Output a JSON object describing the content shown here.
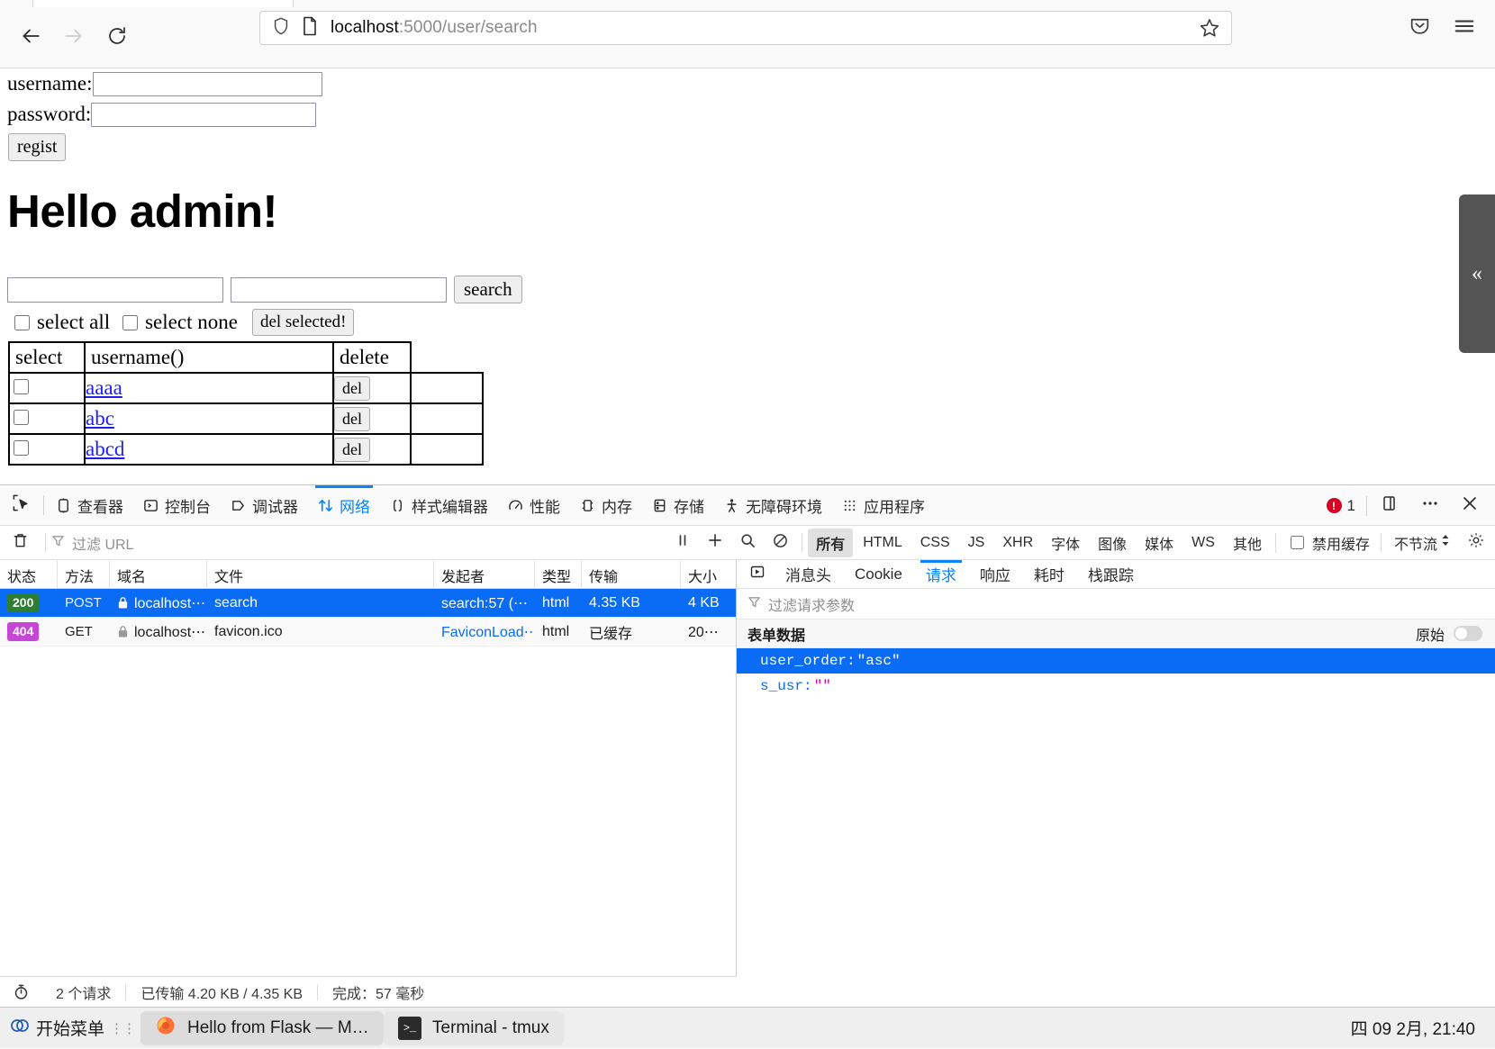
{
  "browser": {
    "url_host": "localhost",
    "url_path": ":5000/user/search",
    "back_icon": "back-arrow-icon",
    "forward_icon": "forward-arrow-icon",
    "reload_icon": "reload-icon",
    "shield_icon": "shield-icon",
    "page_icon": "page-document-icon",
    "star_icon": "bookmark-star-icon",
    "pocket_icon": "pocket-icon",
    "menu_icon": "hamburger-menu-icon"
  },
  "page": {
    "username_label": "username:",
    "password_label": "password:",
    "username_value": "",
    "password_value": "",
    "regist_label": "regist",
    "heading": "Hello admin!",
    "search_value_1": "",
    "search_value_2": "",
    "search_label": "search",
    "select_all_label": "select all",
    "select_none_label": "select none",
    "del_selected_label": "del selected!",
    "table": {
      "headers": [
        "select",
        "username()",
        "delete"
      ],
      "rows": [
        {
          "username": "aaaa",
          "del_label": "del",
          "checked": false
        },
        {
          "username": "abc",
          "del_label": "del",
          "checked": false
        },
        {
          "username": "abcd",
          "del_label": "del",
          "checked": false
        }
      ]
    },
    "side_handle_icon": "collapse-left-chevrons"
  },
  "devtools": {
    "tabs": [
      {
        "label": "查看器",
        "icon": "inspector-icon",
        "active": false
      },
      {
        "label": "控制台",
        "icon": "console-icon",
        "active": false
      },
      {
        "label": "调试器",
        "icon": "debugger-icon",
        "active": false
      },
      {
        "label": "网络",
        "icon": "network-icon",
        "active": true
      },
      {
        "label": "样式编辑器",
        "icon": "style-editor-icon",
        "active": false
      },
      {
        "label": "性能",
        "icon": "performance-icon",
        "active": false
      },
      {
        "label": "内存",
        "icon": "memory-icon",
        "active": false
      },
      {
        "label": "存储",
        "icon": "storage-icon",
        "active": false
      },
      {
        "label": "无障碍环境",
        "icon": "accessibility-icon",
        "active": false
      },
      {
        "label": "应用程序",
        "icon": "application-icon",
        "active": false
      }
    ],
    "error_count": "1",
    "filterbar": {
      "filter_placeholder": "过滤 URL",
      "types": [
        {
          "label": "所有",
          "active": true
        },
        {
          "label": "HTML",
          "active": false
        },
        {
          "label": "CSS",
          "active": false
        },
        {
          "label": "JS",
          "active": false
        },
        {
          "label": "XHR",
          "active": false
        },
        {
          "label": "字体",
          "active": false
        },
        {
          "label": "图像",
          "active": false
        },
        {
          "label": "媒体",
          "active": false
        },
        {
          "label": "WS",
          "active": false
        },
        {
          "label": "其他",
          "active": false
        }
      ],
      "disable_cache_label": "禁用缓存",
      "disable_cache_checked": false,
      "throttle_label": "不节流"
    },
    "table": {
      "headers": [
        "状态",
        "方法",
        "域名",
        "文件",
        "发起者",
        "类型",
        "传输",
        "大小"
      ],
      "rows": [
        {
          "status": "200",
          "status_kind": "ok",
          "method": "POST",
          "domain": "localhost⋯",
          "file": "search",
          "initiator": "search:57 (⋯",
          "type": "html",
          "transferred": "4.35 KB",
          "size": "4 KB",
          "selected": true
        },
        {
          "status": "404",
          "status_kind": "error",
          "method": "GET",
          "domain": "localhost⋯",
          "file": "favicon.ico",
          "initiator": "FaviconLoad⋯",
          "type": "html",
          "transferred": "已缓存",
          "size": "20⋯",
          "selected": false
        }
      ]
    },
    "detail": {
      "tabs": [
        {
          "label": "消息头",
          "active": false
        },
        {
          "label": "Cookie",
          "active": false
        },
        {
          "label": "请求",
          "active": true
        },
        {
          "label": "响应",
          "active": false
        },
        {
          "label": "耗时",
          "active": false
        },
        {
          "label": "栈跟踪",
          "active": false
        }
      ],
      "filter_placeholder": "过滤请求参数",
      "section_title": "表单数据",
      "raw_label": "原始",
      "raw_enabled": false,
      "params": [
        {
          "key": "user_order:",
          "value": "\"asc\"",
          "selected": true
        },
        {
          "key": "s_usr:",
          "value": "\"\"",
          "selected": false
        }
      ]
    },
    "status": {
      "requests": "2 个请求",
      "transferred": "已传输 4.20 KB / 4.35 KB",
      "finish": "完成：57 毫秒"
    }
  },
  "taskbar": {
    "start_label": "开始菜单",
    "tasks": [
      {
        "label": "Hello from Flask — Mozilla⋯",
        "icon": "firefox-icon",
        "active": true
      },
      {
        "label": "Terminal - tmux",
        "icon": "terminal-icon",
        "active": false
      }
    ],
    "clock": "四 09 2月, 21:40"
  }
}
